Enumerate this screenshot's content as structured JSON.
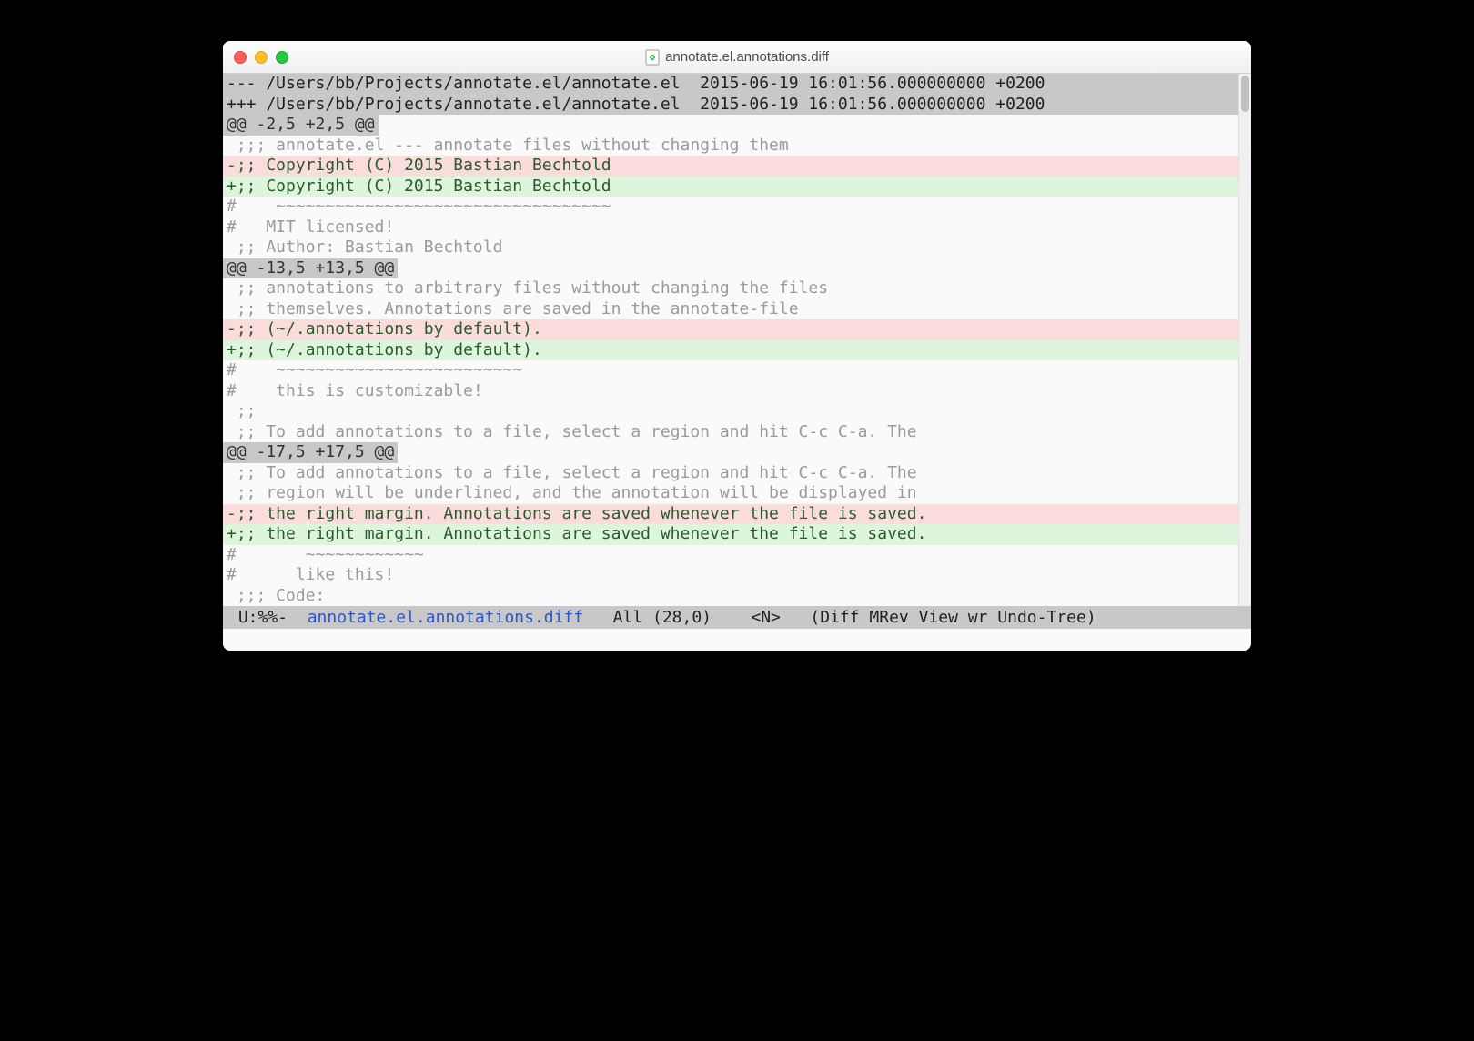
{
  "window": {
    "title": "annotate.el.annotations.diff"
  },
  "diff": {
    "header_removed": "--- /Users/bb/Projects/annotate.el/annotate.el  2015-06-19 16:01:56.000000000 +0200",
    "header_added": "+++ /Users/bb/Projects/annotate.el/annotate.el  2015-06-19 16:01:56.000000000 +0200",
    "hunk1": "@@ -2,5 +2,5 @@",
    "ctx1_1": " ;;; annotate.el --- annotate files without changing them",
    "rem1": "-;; Copyright (C) 2015 Bastian Bechtold",
    "add1": "+;; Copyright (C) 2015 Bastian Bechtold",
    "ann1_1": "#    ~~~~~~~~~~~~~~~~~~~~~~~~~~~~~~~~~~",
    "ann1_2": "#   MIT licensed!",
    "blank1": "",
    "ctx1_2": " ;; Author: Bastian Bechtold",
    "hunk2": "@@ -13,5 +13,5 @@",
    "ctx2_1": " ;; annotations to arbitrary files without changing the files",
    "ctx2_2": " ;; themselves. Annotations are saved in the annotate-file",
    "rem2": "-;; (~/.annotations by default).",
    "add2": "+;; (~/.annotations by default).",
    "ann2_1": "#    ~~~~~~~~~~~~~~~~~~~~~~~~~",
    "ann2_2": "#    this is customizable!",
    "ctx2_3": " ;;",
    "ctx2_4": " ;; To add annotations to a file, select a region and hit C-c C-a. The",
    "hunk3": "@@ -17,5 +17,5 @@",
    "ctx3_1": " ;; To add annotations to a file, select a region and hit C-c C-a. The",
    "ctx3_2": " ;; region will be underlined, and the annotation will be displayed in",
    "rem3": "-;; the right margin. Annotations are saved whenever the file is saved.",
    "add3": "+;; the right margin. Annotations are saved whenever the file is saved.",
    "ann3_1": "#       ~~~~~~~~~~~~",
    "ann3_2": "#      like this!",
    "blank2": "",
    "ctx3_3": " ;;; Code:"
  },
  "modeline": {
    "prefix": " U:%%-  ",
    "filename": "annotate.el.annotations.diff",
    "rest": "   All (28,0)    <N>   (Diff MRev View wr Undo-Tree) "
  }
}
